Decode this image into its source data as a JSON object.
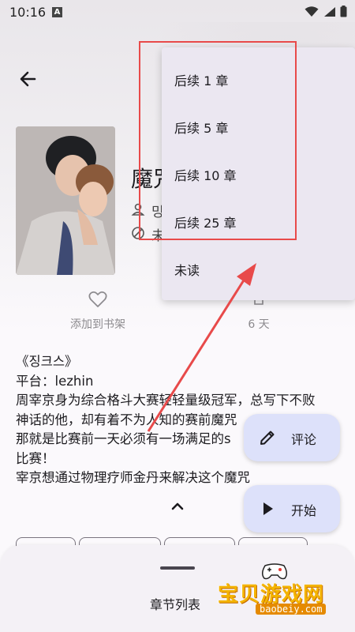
{
  "status_bar": {
    "time": "10:16",
    "notification_badge": "A"
  },
  "book": {
    "title": "魔咒",
    "author": "밍",
    "status": "未"
  },
  "actions": {
    "favorite_label": "添加到书架",
    "days_label": "6 天"
  },
  "description": {
    "lines": [
      "《징크스》",
      "平台：lezhin",
      "周宰京身为综合格斗大赛轻轻量级冠军，总写下不败",
      "神话的他，却有着不为人知的赛前魔咒",
      "那就是比赛前一天必须有一场满足的s",
      "比赛！",
      "宰京想通过物理疗师金丹来解决这个魔咒"
    ]
  },
  "fabs": {
    "comment_label": "评论",
    "start_label": "开始"
  },
  "bottom_sheet": {
    "label": "章节列表"
  },
  "dropdown_menu": {
    "items": [
      {
        "label": "后续 1 章"
      },
      {
        "label": "后续 5 章"
      },
      {
        "label": "后续 10 章"
      },
      {
        "label": "后续 25 章"
      },
      {
        "label": "未读"
      }
    ]
  },
  "watermark": {
    "text": "宝贝游戏网",
    "domain": "baobeiy.com"
  },
  "colors": {
    "highlight": "#e84a4a",
    "fab": "#dde1fa",
    "menu": "#ebe7f1"
  },
  "icons": [
    "back-arrow-icon",
    "user-icon",
    "status-icon",
    "heart-icon",
    "days-icon",
    "pencil-icon",
    "play-icon",
    "chevron-up-icon"
  ]
}
